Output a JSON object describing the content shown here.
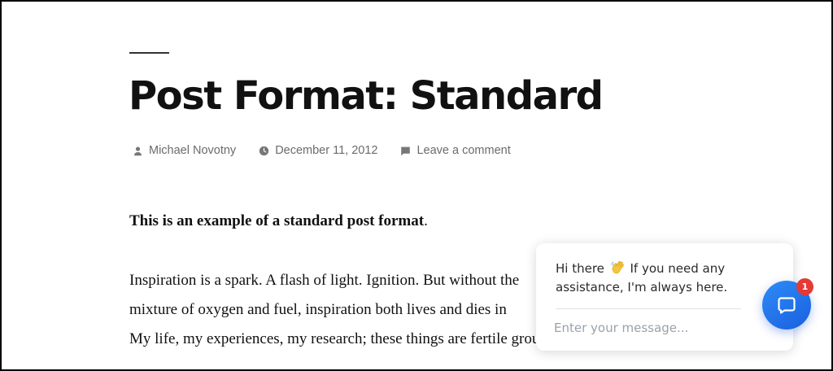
{
  "post": {
    "title": "Post Format: Standard",
    "meta": {
      "author": "Michael Novotny",
      "author_icon": "person-icon",
      "date": "December 11, 2012",
      "date_icon": "clock-icon",
      "comments": "Leave a comment",
      "comments_icon": "comment-icon"
    },
    "content": {
      "lead_bold": "This is an example of a standard post format",
      "lead_end": ".",
      "paragraph_lines": [
        "Inspiration is a spark. A flash of light. Ignition. But without the",
        "mixture of oxygen and fuel, inspiration both lives and dies in",
        "My life, my experiences, my research; these things are fertile ground for"
      ]
    }
  },
  "chat": {
    "greeting_prefix": "Hi there",
    "greeting_suffix": "If you need any assistance, I'm always here.",
    "wave_icon": "waving-hand-icon",
    "input_placeholder": "Enter your message...",
    "launcher_icon": "chat-bubble-icon",
    "badge_count": "1",
    "accent_color": "#1a6ff0",
    "badge_color": "#e53935"
  }
}
